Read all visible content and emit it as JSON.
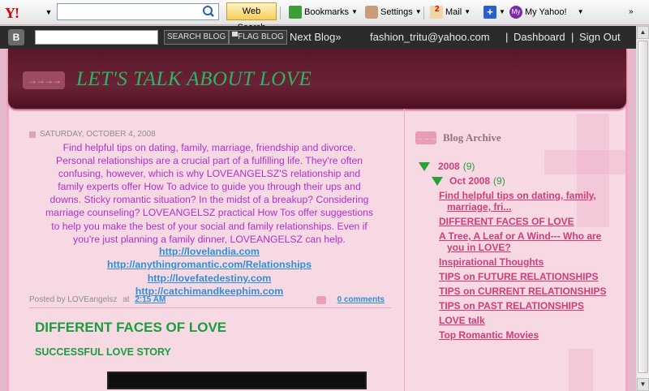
{
  "yahoo_toolbar": {
    "logo": "Y!",
    "search_placeholder": "",
    "web_search_label": "Web Search",
    "bookmarks_label": "Bookmarks",
    "settings_label": "Settings",
    "mail_label": "Mail",
    "mail_count": "2",
    "myyahoo_label": "My Yahoo!"
  },
  "blogger_nav": {
    "search_blog_label": "SEARCH BLOG",
    "flag_blog_label": "FLAG BLOG",
    "next_blog_label": "Next Blog»",
    "email": "fashion_tritu@yahoo.com",
    "dashboard_label": "Dashboard",
    "signout_label": "Sign Out",
    "separator": "|"
  },
  "blog": {
    "title": "LET'S TALK ABOUT LOVE"
  },
  "post1": {
    "date": "SATURDAY, OCTOBER 4, 2008",
    "body_lines": [
      "Find helpful tips on dating, family, marriage, friendship and divorce.",
      "Personal relationships are a crucial part of a fulfilling life. They're often",
      "confusing, however, which is why LOVEANGELSZ'S relationship and",
      "family experts offer How To advice to guide you through their ups and",
      "downs. Sticky romantic situation? In the midst of a breakup? Considering",
      "marriage counseling? LOVEANGELSZ practical How Tos offer suggestions",
      "to help you make the best of your social and family relationships. Even if",
      "you're just planning a family dinner, LOVEANGELSZ can help."
    ],
    "links": [
      "http://lovelandia.com",
      "http://anythingromantic.com/Relationships",
      "http://lovefatedestiny.com",
      "http://catchimandkeephim.com"
    ],
    "posted_by": "Posted by LOVEangelsz",
    "at": "at",
    "time": "2:15 AM",
    "comments": "0 comments"
  },
  "post2": {
    "title": "DIFFERENT FACES OF LOVE",
    "subtitle": "SUCCESSFUL LOVE STORY"
  },
  "sidebar": {
    "heading": "Blog Archive",
    "year": "2008",
    "year_count": "(9)",
    "month": "Oct 2008",
    "month_count": "(9)",
    "posts": [
      {
        "line1": "Find helpful tips on dating, family,",
        "line2": "marriage, fri..."
      },
      {
        "line1": "DIFFERENT FACES OF LOVE",
        "line2": ""
      },
      {
        "line1": "A Tree, A Leaf or A Wind--- Who are",
        "line2": "you in LOVE?"
      },
      {
        "line1": "Inspirational Thoughts",
        "line2": ""
      },
      {
        "line1": "TIPS on FUTURE RELATIONSHIPS",
        "line2": ""
      },
      {
        "line1": "TIPS on CURRENT RELATIONSHIPS",
        "line2": ""
      },
      {
        "line1": "TIPS on PAST RELATIONSHIPS",
        "line2": ""
      },
      {
        "line1": "LOVE talk",
        "line2": ""
      },
      {
        "line1": "Top Romantic Movies",
        "line2": ""
      }
    ]
  },
  "colors": {
    "header_bg": "#5a1728",
    "title_green": "#2bb565",
    "post_text": "#b330cc",
    "link_blue": "#2f8fd6",
    "archive_pink": "#d43b7a"
  }
}
